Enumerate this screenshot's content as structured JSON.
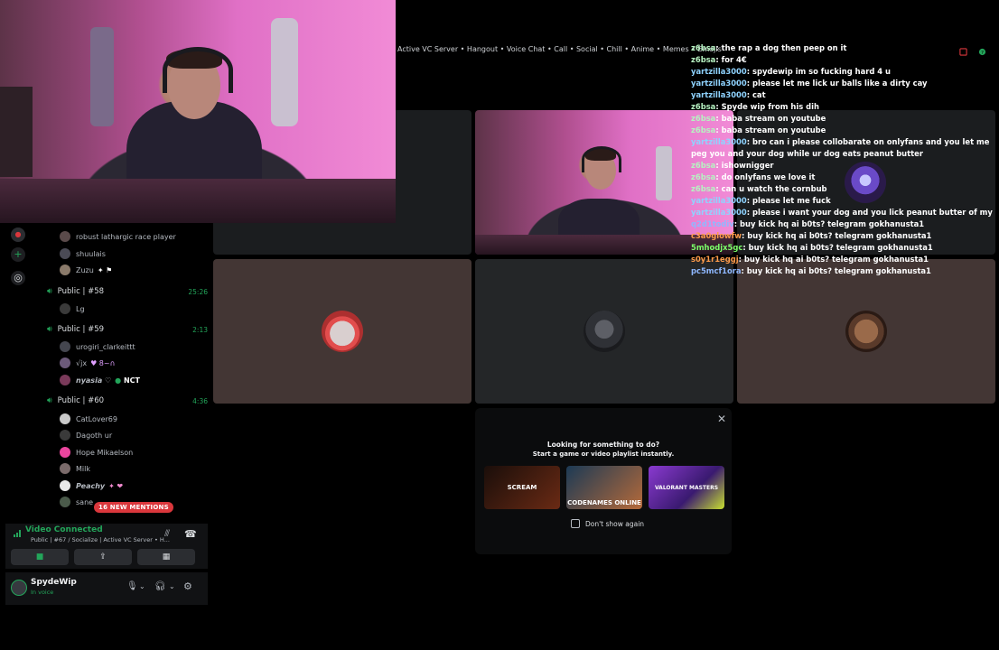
{
  "window": {
    "channel_header": "Active VC Server • Hangout • Voice Chat • Call • Social • Chill • Anime • Memes • Emojis"
  },
  "colors": {
    "accent_green": "#23a55a",
    "mention_red": "#da373c"
  },
  "sidebar": {
    "top_users": [
      {
        "name": "robust lathargic race player"
      },
      {
        "name": "shuulais"
      },
      {
        "name": "Zuzu"
      }
    ],
    "channels": [
      {
        "name": "Public | #58",
        "time": "25:26",
        "users": [
          "Lg"
        ]
      },
      {
        "name": "Public | #59",
        "time": "2:13",
        "users": [
          "urogiri_clarkeittt",
          "√jx",
          "nyasia ♡"
        ]
      },
      {
        "name": "Public | #60",
        "time": "4:36",
        "users": [
          "CatLover69",
          "Dagoth ur",
          "Hope Mikaelson",
          "Milk",
          "Peachy",
          "sane"
        ]
      }
    ],
    "badge_nct": "NCT",
    "mentions_pill": "16 NEW MENTIONS"
  },
  "voice_panel": {
    "status": "Video Connected",
    "location": "Public | #67 / Socialize | Active VC Server • H..."
  },
  "user_panel": {
    "username": "SpydeWip",
    "status": "In voice"
  },
  "chat": [
    {
      "user": "z6bsa",
      "color": "#b6f2c1",
      "text": "the rap a dog then peep on it"
    },
    {
      "user": "z6bsa",
      "color": "#b6f2c1",
      "text": "for 4€"
    },
    {
      "user": "yartzilla3000",
      "color": "#8fd3ff",
      "text": "spydewip im so fucking hard 4 u"
    },
    {
      "user": "yartzilla3000",
      "color": "#8fd3ff",
      "text": "please let me lick ur balls like a dirty cay"
    },
    {
      "user": "yartzilla3000",
      "color": "#8fd3ff",
      "text": "cat"
    },
    {
      "user": "z6bsa",
      "color": "#b6f2c1",
      "text": "Spyde wip from his dih"
    },
    {
      "user": "z6bsa",
      "color": "#b6f2c1",
      "text": "baba stream on youtube"
    },
    {
      "user": "z6bsa",
      "color": "#b6f2c1",
      "text": "baba stream on youtube"
    },
    {
      "user": "yartzilla3000",
      "color": "#8fd3ff",
      "text": "bro can i please collobarate on onlyfans and you let me peg you and your dog while ur dog eats peanut butter",
      "wrap": true
    },
    {
      "user": "z6bsa",
      "color": "#b6f2c1",
      "text": "ishownigger"
    },
    {
      "user": "z6bsa",
      "color": "#b6f2c1",
      "text": "do onlyfans we love it"
    },
    {
      "user": "z6bsa",
      "color": "#b6f2c1",
      "text": "can u watch the cornbub"
    },
    {
      "user": "yartzilla3000",
      "color": "#8fd3ff",
      "text": "please let me fuck"
    },
    {
      "user": "yartzilla3000",
      "color": "#8fd3ff",
      "text": "please i want your dog and you lick peanut butter of my dick"
    },
    {
      "user": "q2d1todiv",
      "color": "#8fb8ff",
      "text": "buy kick hq ai b0ts? telegram gokhanusta1"
    },
    {
      "user": "c3a0glowfw",
      "color": "#ff9b4a",
      "text": "buy kick hq ai b0ts? telegram gokhanusta1"
    },
    {
      "user": "5mhodjx5gc",
      "color": "#7dff6a",
      "text": "buy kick hq ai b0ts? telegram gokhanusta1"
    },
    {
      "user": "s0y1r1eggj",
      "color": "#ff9b4a",
      "text": "buy kick hq ai b0ts? telegram gokhanusta1"
    },
    {
      "user": "pc5mcf1ora",
      "color": "#8fb8ff",
      "text": "buy kick hq ai b0ts? telegram gokhanusta1"
    }
  ],
  "activity_popup": {
    "line1": "Looking for something to do?",
    "line2": "Start a game or video playlist instantly.",
    "cards": [
      {
        "title": "SCREAM",
        "bg": "#3a1e14"
      },
      {
        "title": "CODENAMES ONLINE",
        "bg": "#2a4a66"
      },
      {
        "title": "VALORANT MASTERS",
        "bg": "#6a2aa0"
      }
    ],
    "dont_show": "Don't show again"
  }
}
